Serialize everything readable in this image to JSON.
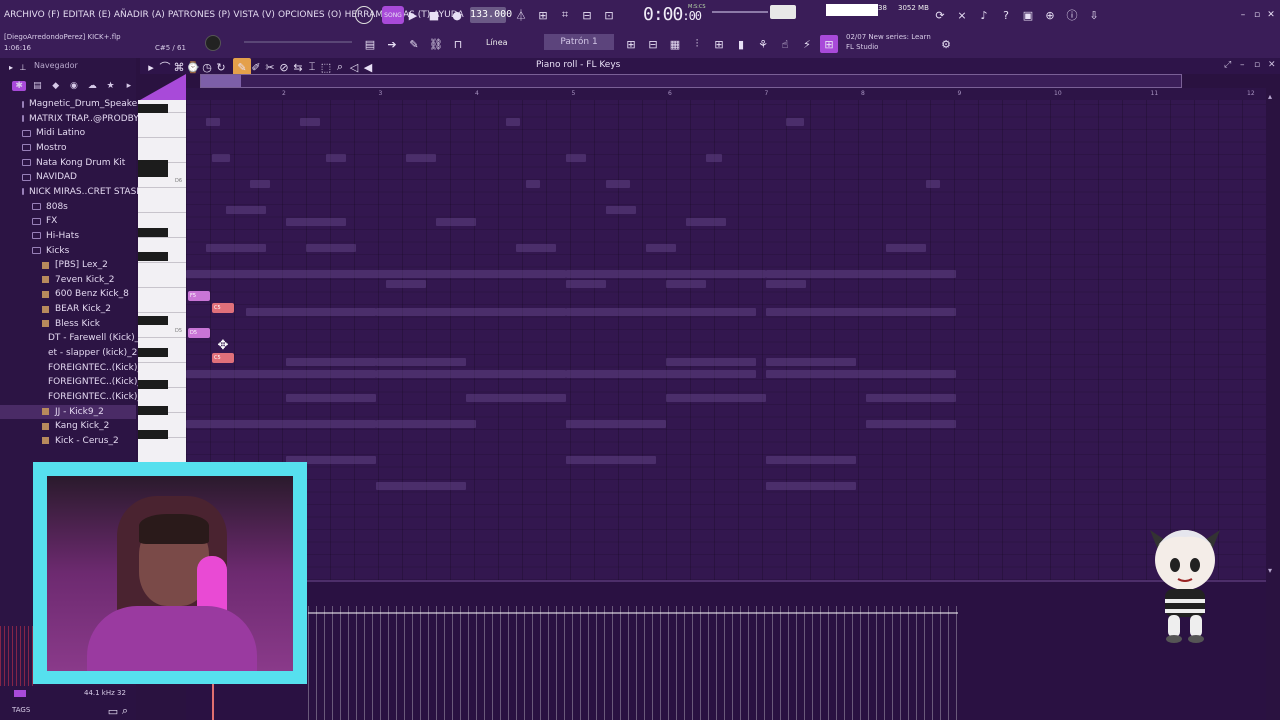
{
  "menubar": {
    "items": [
      "ARCHIVO (F)",
      "EDITAR (E)",
      "AÑADIR (A)",
      "PATRONES (P)",
      "VISTA (V)",
      "OPCIONES (O)",
      "HERRAMIENTAS (T)",
      "AYUDA"
    ],
    "tempo": "133.000",
    "time_main": "0:00",
    "time_sub": ":00",
    "time_unit": "M:S:CS",
    "cpu": "38",
    "memory": "3052 MB",
    "voices": "11"
  },
  "toolbar2": {
    "project_path": "[DiegoArredondoPerez] KICK+.flp",
    "project_time": "1:06:16",
    "counter": "C#5 / 61",
    "snap": "Línea",
    "pattern": "Patrón 1",
    "news_date": "02/07",
    "news_title": "New series: Learn",
    "news_source": "FL Studio"
  },
  "browser": {
    "title": "Navegador",
    "items": [
      {
        "label": "Magnetic_Drum_Speakers",
        "type": "folder",
        "indent": 1
      },
      {
        "label": "MATRIX TRAP..@PRODBYLIJS",
        "type": "folder",
        "indent": 1
      },
      {
        "label": "Midi Latino",
        "type": "folder",
        "indent": 1
      },
      {
        "label": "Mostro",
        "type": "folder",
        "indent": 1
      },
      {
        "label": "Nata Kong Drum Kit",
        "type": "folder",
        "indent": 1
      },
      {
        "label": "NAVIDAD",
        "type": "folder",
        "indent": 1
      },
      {
        "label": "NICK MIRAS..CRET STASH",
        "type": "folder",
        "indent": 1
      },
      {
        "label": "808s",
        "type": "folder",
        "indent": 2
      },
      {
        "label": "FX",
        "type": "folder",
        "indent": 2
      },
      {
        "label": "Hi-Hats",
        "type": "folder",
        "indent": 2
      },
      {
        "label": "Kicks",
        "type": "folder",
        "indent": 2
      },
      {
        "label": "[PBS] Lex_2",
        "type": "file",
        "indent": 3
      },
      {
        "label": "7even Kick_2",
        "type": "file",
        "indent": 3
      },
      {
        "label": "600 Benz Kick_8",
        "type": "file",
        "indent": 3
      },
      {
        "label": "BEAR Kick_2",
        "type": "file",
        "indent": 3
      },
      {
        "label": "Bless Kick",
        "type": "file",
        "indent": 3
      },
      {
        "label": "DT - Farewell (Kick)_2",
        "type": "file",
        "indent": 3
      },
      {
        "label": "et - slapper (kick)_2",
        "type": "file",
        "indent": 3
      },
      {
        "label": "FOREIGNTEC..(Kick)_2",
        "type": "file",
        "indent": 3
      },
      {
        "label": "FOREIGNTEC..(Kick)_3",
        "type": "file",
        "indent": 3
      },
      {
        "label": "FOREIGNTEC..(Kick)_2",
        "type": "file",
        "indent": 3
      },
      {
        "label": "JJ - Kick9_2",
        "type": "file",
        "indent": 3,
        "selected": true
      },
      {
        "label": "Kang Kick_2",
        "type": "file",
        "indent": 3
      },
      {
        "label": "Kick - Cerus_2",
        "type": "file",
        "indent": 3
      }
    ],
    "tags_label": "TAGS",
    "sample_rate": "44.1 kHz 32"
  },
  "pianoroll": {
    "title": "Piano roll - FL Keys",
    "bars": [
      "2",
      "3",
      "4",
      "5",
      "6",
      "7",
      "8",
      "9",
      "10",
      "11",
      "12"
    ],
    "key_labels": [
      "D6",
      "D5"
    ],
    "notes": [
      {
        "label": "F5",
        "color": "#c975d6"
      },
      {
        "label": "C5",
        "color": "#e0707a"
      },
      {
        "label": "D5",
        "color": "#c975d6"
      },
      {
        "label": "C5",
        "color": "#e0707a"
      }
    ]
  },
  "colors": {
    "accent": "#a84ad9",
    "note_pink": "#e0707a",
    "note_purple": "#c975d6",
    "webcam_border": "#56e0ee"
  }
}
